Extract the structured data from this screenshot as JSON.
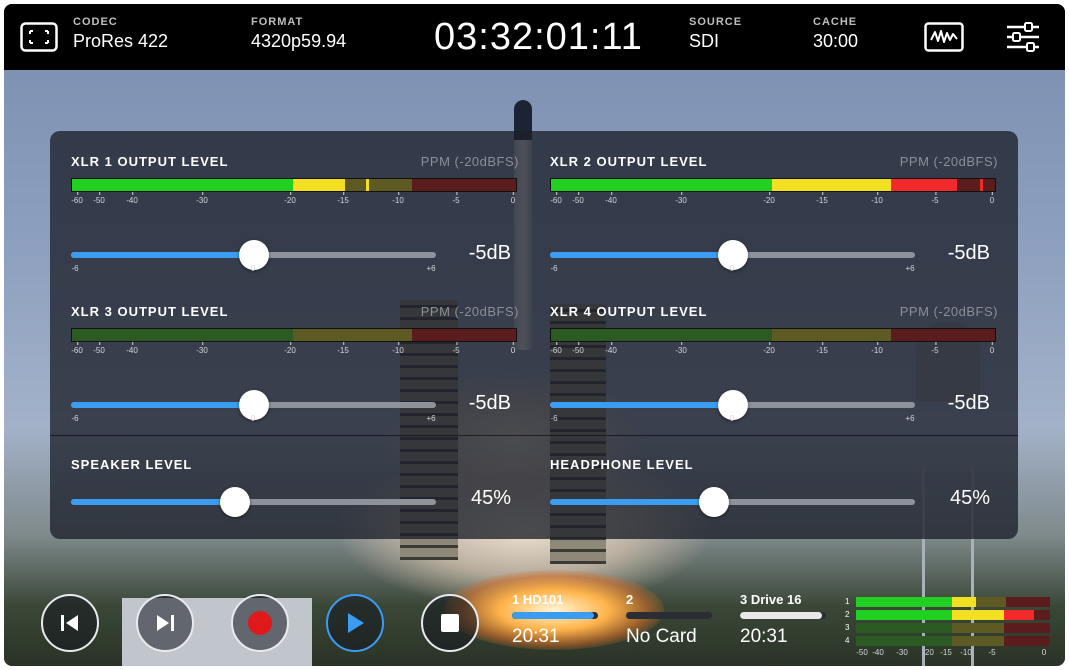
{
  "topbar": {
    "codec_label": "CODEC",
    "codec_value": "ProRes 422",
    "format_label": "FORMAT",
    "format_value": "4320p59.94",
    "timecode": "03:32:01:11",
    "source_label": "SOURCE",
    "source_value": "SDI",
    "cache_label": "CACHE",
    "cache_value": "30:00",
    "icons": [
      "frame-guides-icon",
      "waveform-icon",
      "settings-sliders-icon"
    ]
  },
  "meter_scale": [
    "-60",
    "-50",
    "-40",
    "-30",
    "-20",
    "-15",
    "-10",
    "-5",
    "0"
  ],
  "channels": [
    {
      "title": "XLR 1 OUTPUT LEVEL",
      "ppm": "PPM (-20dBFS)",
      "value": "-5dB",
      "min": "-6",
      "zero": "0",
      "max": "+6",
      "level_fraction": 0.5
    },
    {
      "title": "XLR 2 OUTPUT LEVEL",
      "ppm": "PPM (-20dBFS)",
      "value": "-5dB",
      "min": "-6",
      "zero": "0",
      "max": "+6",
      "level_fraction": 0.5
    },
    {
      "title": "XLR 3 OUTPUT LEVEL",
      "ppm": "PPM (-20dBFS)",
      "value": "-5dB",
      "min": "-6",
      "zero": "0",
      "max": "+6",
      "level_fraction": 0.5
    },
    {
      "title": "XLR 4 OUTPUT LEVEL",
      "ppm": "PPM (-20dBFS)",
      "value": "-5dB",
      "min": "-6",
      "zero": "0",
      "max": "+6",
      "level_fraction": 0.5
    }
  ],
  "speaker": {
    "title": "SPEAKER LEVEL",
    "value": "45%",
    "level_fraction": 0.45
  },
  "headphone": {
    "title": "HEADPHONE LEVEL",
    "value": "45%",
    "level_fraction": 0.45
  },
  "transport": [
    "skip-back-icon",
    "skip-forward-icon",
    "record-icon",
    "play-icon",
    "stop-icon"
  ],
  "drives": [
    {
      "label": "1  HD101",
      "value": "20:31",
      "fill_fraction": 0.95,
      "color": "#3a9df2"
    },
    {
      "label": "2",
      "value": "No Card",
      "fill_fraction": 0,
      "color": "#2a2e34"
    },
    {
      "label": "3  Drive 16",
      "value": "20:31",
      "fill_fraction": 0.95,
      "color": "#e8e8e8"
    }
  ],
  "mini_meter": {
    "channels": [
      "1",
      "2",
      "3",
      "4"
    ],
    "scale": [
      "-50",
      "-40",
      "-30",
      "-20",
      "-15",
      "-10",
      "-5",
      "0"
    ]
  },
  "colors": {
    "accent_blue": "#3a9df2",
    "record_red": "#e0191c",
    "meter_green": "#22d022",
    "meter_yellow": "#f4e022",
    "meter_red": "#f02a2a"
  }
}
